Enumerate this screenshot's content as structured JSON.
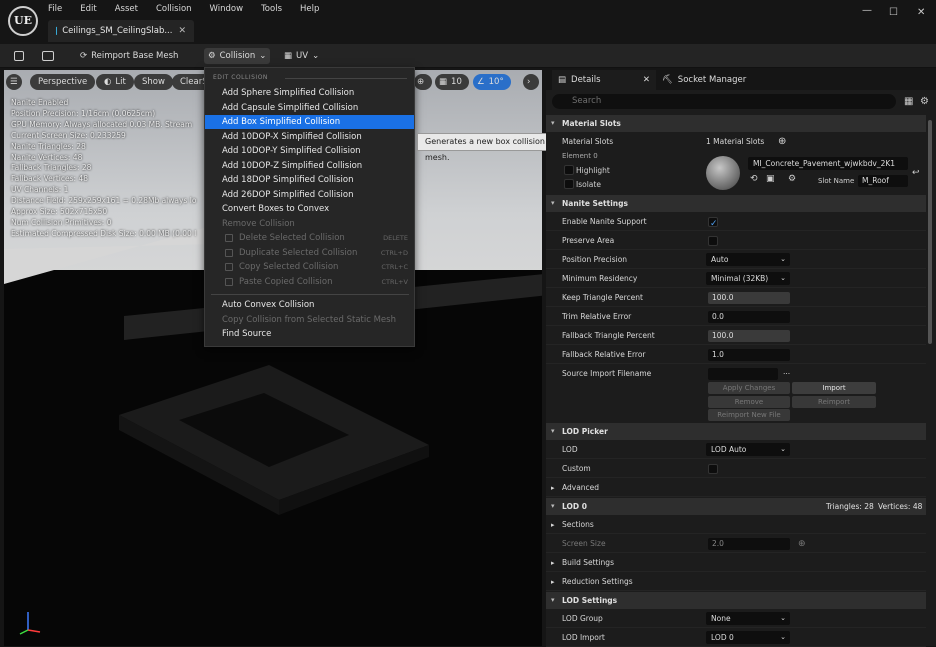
{
  "app": {
    "logo": "UE"
  },
  "menubar": [
    "File",
    "Edit",
    "Asset",
    "Collision",
    "Window",
    "Tools",
    "Help"
  ],
  "doc_tab": {
    "title": "Ceilings_SM_CeilingSlab..."
  },
  "toolbar": {
    "reimport": "Reimport Base Mesh",
    "collision": "Collision",
    "uv": "UV"
  },
  "viewport": {
    "perspective": "Perspective",
    "lit": "Lit",
    "show": "Show",
    "clear": "ClearSl",
    "grid_value": "10",
    "angle_value": "10°",
    "stats": [
      "Nanite Enabled",
      "Position Precision: 1/16cm (0.0625cm)",
      "GPU Memory: Always allocated 0.03 MB. Stream",
      "Current Screen Size: 0.233259",
      "Nanite Triangles: 28",
      "Nanite Vertices: 48",
      "Fallback Triangles: 28",
      "Fallback Vertices: 48",
      "UV Channels: 1",
      "Distance Field: 259x259x161 = 0.28Mb always lo",
      "Approx Size: 502x715x50",
      "Num Collision Primitives: 0",
      "Estimated Compressed Disk Size: 0.00 MB (0.00 I"
    ]
  },
  "collision_menu": {
    "header": "EDIT COLLISION",
    "items": [
      {
        "label": "Add Sphere Simplified Collision"
      },
      {
        "label": "Add Capsule Simplified Collision"
      },
      {
        "label": "Add Box Simplified Collision",
        "selected": true
      },
      {
        "label": "Add 10DOP-X Simplified Collision"
      },
      {
        "label": "Add 10DOP-Y Simplified Collision"
      },
      {
        "label": "Add 10DOP-Z Simplified Collision"
      },
      {
        "label": "Add 18DOP Simplified Collision"
      },
      {
        "label": "Add 26DOP Simplified Collision"
      },
      {
        "label": "Convert Boxes to Convex"
      },
      {
        "label": "Remove Collision",
        "disabled": true
      },
      {
        "label": "Delete Selected Collision",
        "disabled": true,
        "shortcut": "DELETE"
      },
      {
        "label": "Duplicate Selected Collision",
        "disabled": true,
        "shortcut": "CTRL+D"
      },
      {
        "label": "Copy Selected Collision",
        "disabled": true,
        "shortcut": "CTRL+C"
      },
      {
        "label": "Paste Copied Collision",
        "disabled": true,
        "shortcut": "CTRL+V"
      },
      {
        "label": "Auto Convex Collision"
      },
      {
        "label": "Copy Collision from Selected Static Mesh",
        "disabled": true
      },
      {
        "label": "Find Source"
      }
    ]
  },
  "tooltip": "Generates a new box collision mesh encompassing the static mesh.",
  "details": {
    "tab_details": "Details",
    "tab_socket": "Socket Manager",
    "search_placeholder": "Search",
    "material_slots": {
      "header": "Material Slots",
      "label": "Material Slots",
      "count": "1 Material Slots",
      "element": "Element 0",
      "highlight": "Highlight",
      "isolate": "Isolate",
      "material": "MI_Concrete_Pavement_wjwkbdv_2K1",
      "slot_name_label": "Slot Name",
      "slot_name": "M_Roof"
    },
    "nanite": {
      "header": "Nanite Settings",
      "rows": [
        {
          "label": "Enable Nanite Support"
        },
        {
          "label": "Preserve Area"
        },
        {
          "label": "Position Precision",
          "value": "Auto"
        },
        {
          "label": "Minimum Residency",
          "value": "Minimal (32KB)"
        },
        {
          "label": "Keep Triangle Percent",
          "value": "100.0"
        },
        {
          "label": "Trim Relative Error",
          "value": "0.0"
        },
        {
          "label": "Fallback Triangle Percent",
          "value": "100.0"
        },
        {
          "label": "Fallback Relative Error",
          "value": "1.0"
        },
        {
          "label": "Source Import Filename",
          "value": "..."
        }
      ],
      "buttons": [
        "Apply Changes",
        "Import",
        "Remove",
        "Reimport",
        "Reimport New File"
      ]
    },
    "lod_picker": {
      "header": "LOD Picker",
      "lod_label": "LOD",
      "lod_value": "LOD Auto",
      "custom": "Custom",
      "advanced": "Advanced"
    },
    "lod0": {
      "header": "LOD 0",
      "triangles": "Triangles: 28",
      "vertices": "Vertices: 48",
      "sections": "Sections",
      "screen_size_label": "Screen Size",
      "screen_size": "2.0",
      "build": "Build Settings",
      "reduction": "Reduction Settings"
    },
    "lod_settings": {
      "header": "LOD Settings",
      "group_label": "LOD Group",
      "group_value": "None",
      "import_label": "LOD Import",
      "import_value": "LOD 0"
    }
  }
}
